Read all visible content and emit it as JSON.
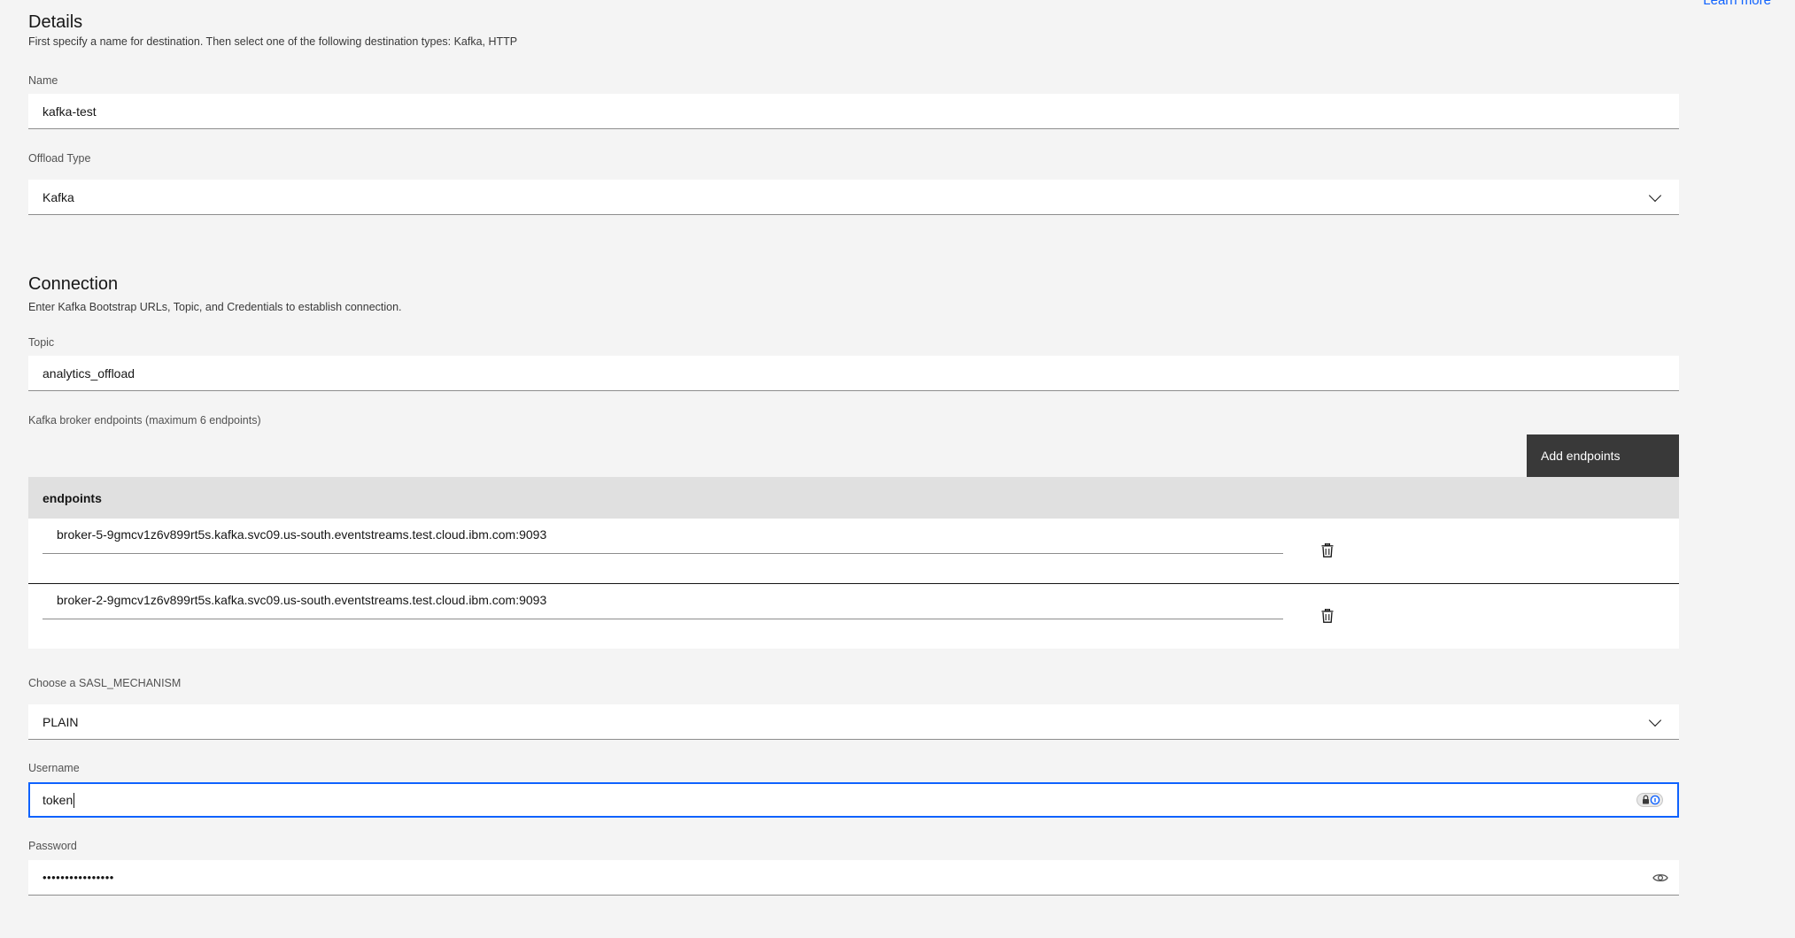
{
  "header": {
    "learn_more": "Learn more"
  },
  "details": {
    "title": "Details",
    "description": "First specify a name for destination. Then select one of the following destination types: Kafka, HTTP",
    "name_label": "Name",
    "name_value": "kafka-test",
    "offload_label": "Offload Type",
    "offload_value": "Kafka"
  },
  "connection": {
    "title": "Connection",
    "description": "Enter Kafka Bootstrap URLs, Topic, and Credentials to establish connection.",
    "topic_label": "Topic",
    "topic_value": "analytics_offload",
    "endpoints_label": "Kafka broker endpoints (maximum 6 endpoints)",
    "add_button": "Add endpoints",
    "table_header": "endpoints",
    "endpoints": [
      "broker-5-9gmcv1z6v899rt5s.kafka.svc09.us-south.eventstreams.test.cloud.ibm.com:9093",
      "broker-2-9gmcv1z6v899rt5s.kafka.svc09.us-south.eventstreams.test.cloud.ibm.com:9093"
    ],
    "sasl_label": "Choose a SASL_MECHANISM",
    "sasl_value": "PLAIN",
    "username_label": "Username",
    "username_value": "token",
    "password_label": "Password",
    "password_value": "••••••••••••••••"
  },
  "colors": {
    "background": "#f4f4f4",
    "focus": "#0f62fe",
    "button": "#393939",
    "table_header": "#e0e0e0"
  }
}
